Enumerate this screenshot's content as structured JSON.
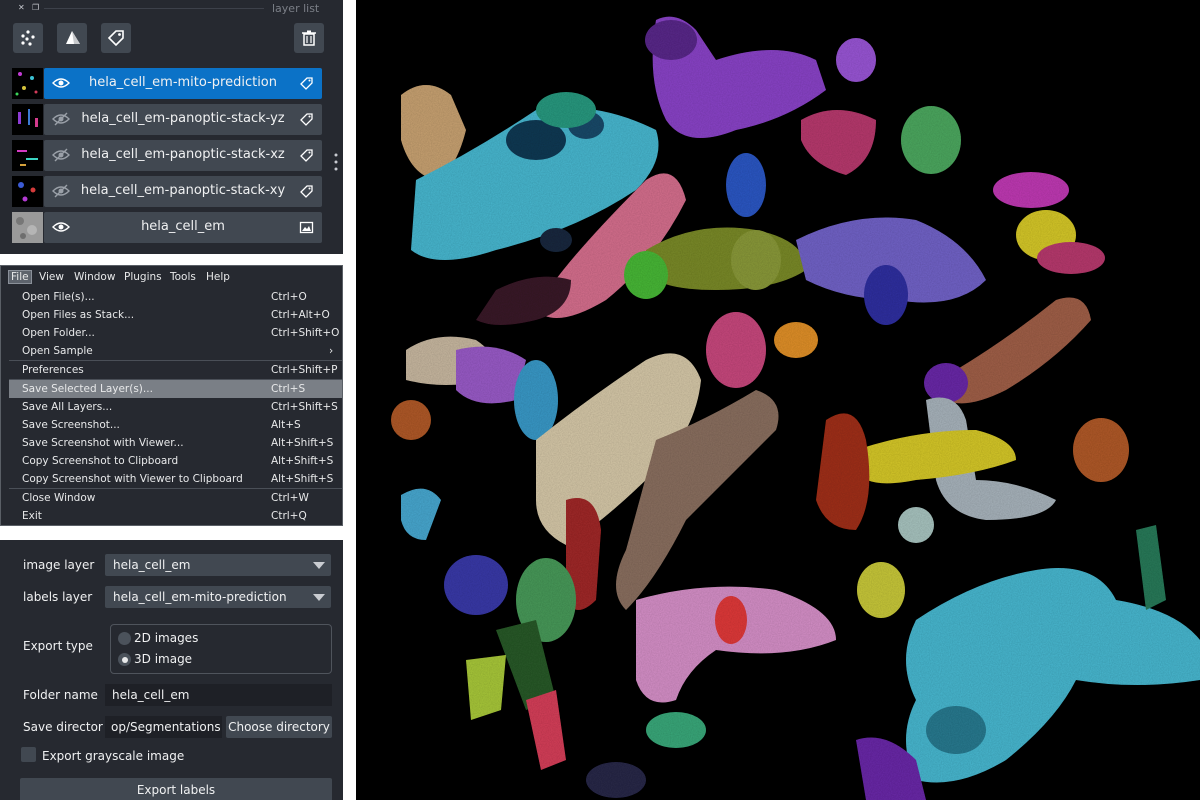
{
  "layer_panel": {
    "title": "layer list",
    "tool_buttons": [
      {
        "icon": "points-layer-icon"
      },
      {
        "icon": "shapes-layer-icon"
      },
      {
        "icon": "labels-layer-icon"
      }
    ],
    "delete_icon": "trash-icon",
    "layers": [
      {
        "name": "hela_cell_em-mito-prediction",
        "visible": true,
        "selected": true,
        "kind_icon": "label-tag-icon"
      },
      {
        "name": "hela_cell_em-panoptic-stack-yz",
        "visible": false,
        "selected": false,
        "kind_icon": "label-tag-icon"
      },
      {
        "name": "hela_cell_em-panoptic-stack-xz",
        "visible": false,
        "selected": false,
        "kind_icon": "label-tag-icon"
      },
      {
        "name": "hela_cell_em-panoptic-stack-xy",
        "visible": false,
        "selected": false,
        "kind_icon": "label-tag-icon"
      },
      {
        "name": "hela_cell_em",
        "visible": true,
        "selected": false,
        "kind_icon": "image-icon"
      }
    ]
  },
  "menu": {
    "menubar": [
      "File",
      "View",
      "Window",
      "Plugins",
      "Tools",
      "Help"
    ],
    "active_menu": "File",
    "items": [
      {
        "label": "Open File(s)...",
        "shortcut": "Ctrl+O"
      },
      {
        "label": "Open Files as Stack...",
        "shortcut": "Ctrl+Alt+O"
      },
      {
        "label": "Open Folder...",
        "shortcut": "Ctrl+Shift+O"
      },
      {
        "label": "Open Sample",
        "shortcut": "›"
      },
      {
        "label": "Preferences",
        "shortcut": "Ctrl+Shift+P"
      },
      {
        "label": "Save Selected Layer(s)...",
        "shortcut": "Ctrl+S"
      },
      {
        "label": "Save All Layers...",
        "shortcut": "Ctrl+Shift+S"
      },
      {
        "label": "Save Screenshot...",
        "shortcut": "Alt+S"
      },
      {
        "label": "Save Screenshot with Viewer...",
        "shortcut": "Alt+Shift+S"
      },
      {
        "label": "Copy Screenshot to Clipboard",
        "shortcut": "Alt+Shift+S"
      },
      {
        "label": "Copy Screenshot with Viewer to Clipboard",
        "shortcut": "Alt+Shift+S"
      },
      {
        "label": "Close Window",
        "shortcut": "Ctrl+W"
      },
      {
        "label": "Exit",
        "shortcut": "Ctrl+Q"
      }
    ],
    "highlighted_item": "Save Selected Layer(s)..."
  },
  "export": {
    "image_layer_label": "image layer",
    "image_layer_value": "hela_cell_em",
    "labels_layer_label": "labels layer",
    "labels_layer_value": "hela_cell_em-mito-prediction",
    "export_type_label": "Export type",
    "option_2d": "2D images",
    "option_3d": "3D image",
    "selected_option": "3D image",
    "folder_name_label": "Folder name",
    "folder_name_value": "hela_cell_em",
    "save_directory_label": "Save director",
    "save_directory_value": "op/Segmentations",
    "choose_directory": "Choose directory",
    "grayscale_label": "Export grayscale image",
    "grayscale_checked": false,
    "export_button": "Export labels"
  },
  "colors": {
    "panel_bg": "#262930",
    "control_bg": "#414851",
    "selection_blue": "#0b72c7",
    "menu_highlight": "#7a7f86",
    "viewer_bg": "#000000"
  }
}
